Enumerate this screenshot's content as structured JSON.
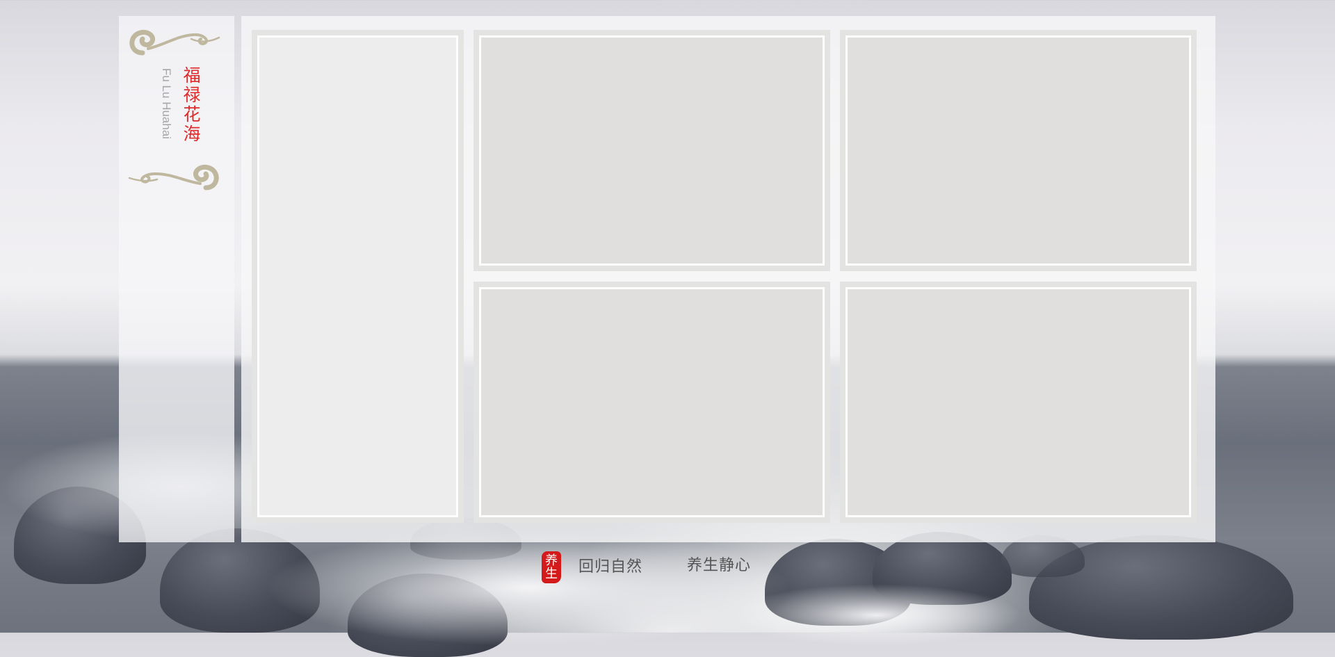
{
  "brand": {
    "name_cn": "福禄花海",
    "name_en": "Fu Lu Huahai"
  },
  "seal": {
    "line1": "养",
    "line2": "生",
    "color": "#d41a1a"
  },
  "slogans": [
    "回归自然",
    "养生静心"
  ],
  "colors": {
    "accent": "#e02a2a",
    "cloud": "#bfb89f",
    "frame": "#e3e3e1"
  },
  "photo_slots": [
    "tall-left",
    "top-middle",
    "top-right",
    "bottom-middle",
    "bottom-right"
  ]
}
